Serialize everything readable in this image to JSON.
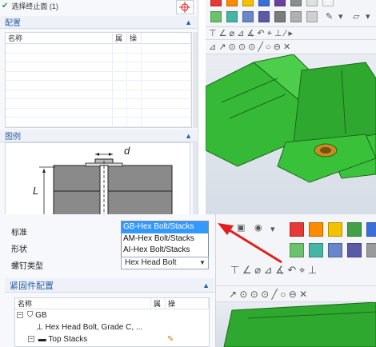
{
  "top_panel": {
    "selection_text": "选择终止面 (1)",
    "config_section": "配置",
    "params_columns": [
      "名称",
      "属",
      "操"
    ],
    "diagram_section": "图例",
    "diagram_labels": {
      "d": "d",
      "L": "L"
    }
  },
  "bottom_panel": {
    "standard_label": "标准",
    "shape_label": "形状",
    "thread_label": "螺钉类型",
    "standard_options": [
      "GB-Hex Bolt/Stacks",
      "AM-Hex Bolt/Stacks",
      "AI-Hex Bolt/Stacks"
    ],
    "selected_standard_index": 0,
    "thread_value": "Hex Head Bolt",
    "fastener_section": "紧固件配置",
    "tree_columns": [
      "名称",
      "属",
      "操"
    ],
    "tree": [
      {
        "label": "GB",
        "level": 0
      },
      {
        "label": "Hex Head Bolt, Grade C, ...",
        "level": 1
      },
      {
        "label": "Top Stacks",
        "level": 1
      }
    ]
  },
  "colors": {
    "accent": "#2a5ea8",
    "selection": "#3399ff",
    "model_green": "#2fbf2f",
    "annotation_red": "#e02020",
    "top_swatches_row1": [
      "#e53935",
      "#fb8c00",
      "#f2c200",
      "#3b6fd8",
      "#6b3fa0",
      "#8d8d8d",
      "#e0e0e0",
      "#f5f5f5"
    ],
    "top_swatches_row2": [
      "#6cc26c",
      "#47b5a5",
      "#6a86c9",
      "#5a5aa8",
      "#7c7c7c",
      "#b0b0b0",
      "#d0d0d0"
    ],
    "bottom_swatches_row1": [
      "#e53935",
      "#fb8c00",
      "#f2c200",
      "#43a047",
      "#3b6fd8"
    ],
    "bottom_swatches_row2": [
      "#6cc26c",
      "#47b5a5",
      "#6a86c9",
      "#5a5aa8",
      "#9a9a9a"
    ]
  },
  "icons": [
    "check-icon",
    "crosshair-icon",
    "caret-up-icon",
    "chevron-down-icon",
    "tree-root-icon",
    "bolt-icon",
    "stack-icon",
    "edit-icon",
    "sketch-tool-icons"
  ]
}
